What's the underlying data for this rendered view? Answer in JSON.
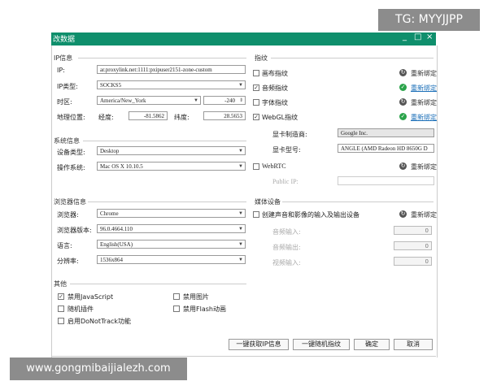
{
  "watermark": {
    "tg": "TG: MYYJJPP",
    "url": "www.gongmibaijialezh.com"
  },
  "window": {
    "title": "改数据"
  },
  "ip_section": {
    "header": "IP信息",
    "ip_label": "IP:",
    "ip_value": "ar.proxylink.net:1111:pxipuser2151-zone-custom",
    "type_label": "IP类型:",
    "type_value": "SOCKS5",
    "timezone_label": "时区:",
    "timezone_value": "America/New_York",
    "timezone_offset": "-240",
    "geo_label": "地理位置:",
    "lon_label": "经度:",
    "lon_value": "-81.5862",
    "lat_label": "纬度:",
    "lat_value": "28.5653"
  },
  "system_section": {
    "header": "系统信息",
    "device_label": "设备类型:",
    "device_value": "Desktop",
    "os_label": "操作系统:",
    "os_value": "Mac OS X 10.10.5"
  },
  "browser_section": {
    "header": "浏览器信息",
    "browser_label": "浏览器:",
    "browser_value": "Chrome",
    "version_label": "浏览器版本:",
    "version_value": "96.0.4664.110",
    "lang_label": "语言:",
    "lang_value": "English(USA)",
    "res_label": "分辨率:",
    "res_value": "1536x864"
  },
  "other_section": {
    "header": "其他",
    "disable_js": "禁用JavaScript",
    "disable_images": "禁用图片",
    "random_plugins": "随机插件",
    "disable_flash": "禁用Flash动画",
    "do_not_track": "启用DoNotTrack功能"
  },
  "fingerprint_section": {
    "header": "指纹",
    "canvas": "画布指纹",
    "audio": "音频指纹",
    "font": "字体指纹",
    "webgl": "WebGL指纹",
    "reset": "重新绑定",
    "gpu_vendor_label": "显卡制造商:",
    "gpu_vendor_value": "Google Inc.",
    "gpu_model_label": "显卡型号:",
    "gpu_model_value": "ANGLE (AMD Radeon HD 8650G D",
    "webrtc": "WebRTC",
    "public_ip_label": "Public IP:"
  },
  "media_section": {
    "header": "媒体设备",
    "create_devices": "创建声音和影像的输入及输出设备",
    "reset": "重新绑定",
    "audio_in_label": "音频输入:",
    "audio_in_value": "0",
    "audio_out_label": "音频输出:",
    "audio_out_value": "0",
    "video_in_label": "视频输入:",
    "video_in_value": "0"
  },
  "buttons": {
    "get_ip": "一键获取IP信息",
    "random_fp": "一键随机指纹",
    "ok": "确定",
    "cancel": "取消"
  },
  "window_controls": {
    "minimize": "_",
    "maximize": "□",
    "close": "×"
  },
  "colors": {
    "titlebar": "#0f8f6c",
    "check_green": "#2aa34a",
    "link_blue": "#1b6fb8"
  }
}
